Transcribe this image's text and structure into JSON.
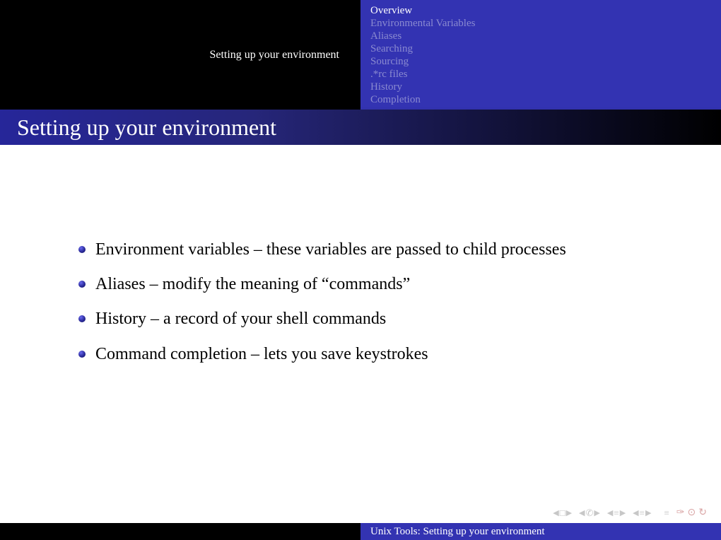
{
  "header": {
    "section_label": "Setting up your environment",
    "nav": [
      {
        "label": "Overview",
        "active": true
      },
      {
        "label": "Environmental Variables",
        "active": false
      },
      {
        "label": "Aliases",
        "active": false
      },
      {
        "label": "Searching",
        "active": false
      },
      {
        "label": "Sourcing",
        "active": false
      },
      {
        "label": ".*rc files",
        "active": false
      },
      {
        "label": "History",
        "active": false
      },
      {
        "label": "Completion",
        "active": false
      }
    ]
  },
  "title": "Setting up your environment",
  "bullets": [
    "Environment variables – these variables are passed to child processes",
    "Aliases – modify the meaning of “commands”",
    "History – a record of your shell commands",
    "Command completion – lets you save keystrokes"
  ],
  "footer": {
    "text": "Unix Tools: Setting up your environment"
  }
}
